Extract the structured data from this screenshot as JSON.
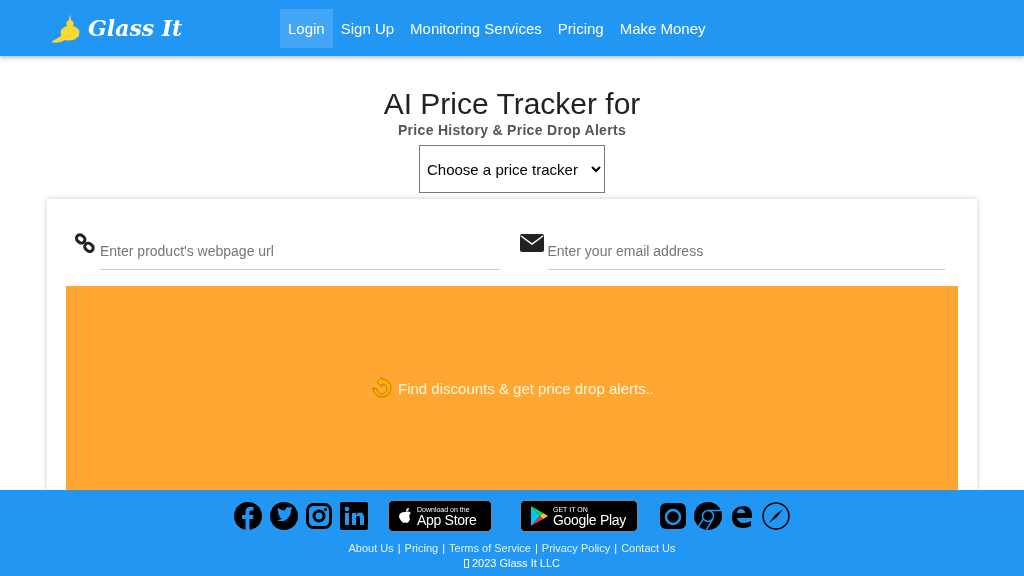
{
  "header": {
    "logo": "Glass It",
    "nav": [
      {
        "label": "Login",
        "selected": true
      },
      {
        "label": "Sign Up",
        "selected": false
      },
      {
        "label": "Monitoring Services",
        "selected": false
      },
      {
        "label": "Pricing",
        "selected": false
      },
      {
        "label": "Make Money",
        "selected": false
      }
    ]
  },
  "hero": {
    "title": "AI Price Tracker for",
    "subtitle": "Price History & Price Drop Alerts",
    "tracker_select": {
      "value": "Choose a price tracker"
    }
  },
  "tracker_form": {
    "url_field": {
      "placeholder": "Enter product's webpage url"
    },
    "email_field": {
      "placeholder": "Enter your email address"
    },
    "banner": "Find discounts & get price drop alerts.."
  },
  "footer": {
    "app_store": {
      "top": "Download on the",
      "bottom": "App Store"
    },
    "google_play": {
      "top": "GET IT ON",
      "bottom": "Google Play"
    },
    "links": [
      {
        "label": "About Us",
        "separator": "|"
      },
      {
        "label": "Pricing",
        "separator": "|"
      },
      {
        "label": "Terms of Service",
        "separator": "|"
      },
      {
        "label": "Privacy Policy",
        "separator": "|"
      },
      {
        "label": "Contact Us"
      }
    ],
    "copyright": "2023 Glass It LLC"
  }
}
